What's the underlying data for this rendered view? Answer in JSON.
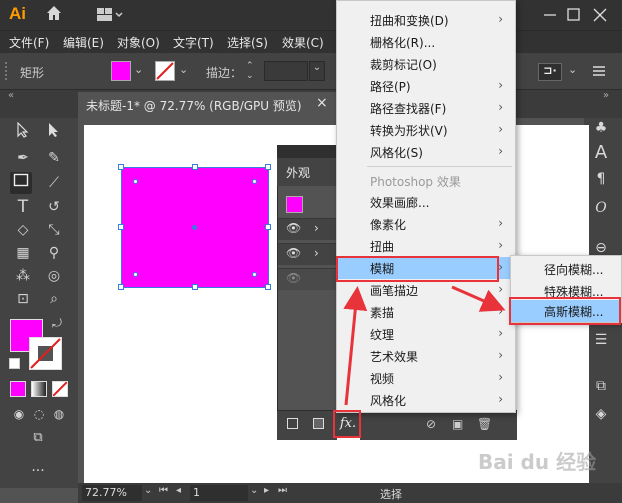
{
  "app": {
    "logo": "Ai"
  },
  "menubar": [
    {
      "label": "文件(F)"
    },
    {
      "label": "编辑(E)"
    },
    {
      "label": "对象(O)"
    },
    {
      "label": "文字(T)"
    },
    {
      "label": "选择(S)"
    },
    {
      "label": "效果(C)"
    }
  ],
  "control_bar": {
    "object_label": "矩形",
    "stroke_label": "描边："
  },
  "document_tab": {
    "title": "未标题-1* @ 72.77% (RGB/GPU 预览)",
    "close": "×"
  },
  "appearance_panel": {
    "title": "外观",
    "fx_label": "fx."
  },
  "effect_menu": {
    "items": [
      {
        "label": "扭曲和变换(D)",
        "has_submenu": true
      },
      {
        "label": "栅格化(R)...",
        "has_submenu": false
      },
      {
        "label": "裁剪标记(O)",
        "has_submenu": false
      },
      {
        "label": "路径(P)",
        "has_submenu": true
      },
      {
        "label": "路径查找器(F)",
        "has_submenu": true
      },
      {
        "label": "转换为形状(V)",
        "has_submenu": true
      },
      {
        "label": "风格化(S)",
        "has_submenu": true
      }
    ],
    "photoshop_header": "Photoshop 效果",
    "ps_items": [
      {
        "label": "效果画廊...",
        "has_submenu": false
      },
      {
        "label": "像素化",
        "has_submenu": true
      },
      {
        "label": "扭曲",
        "has_submenu": true
      },
      {
        "label": "模糊",
        "has_submenu": true,
        "highlighted": true
      },
      {
        "label": "画笔描边",
        "has_submenu": true
      },
      {
        "label": "素描",
        "has_submenu": true
      },
      {
        "label": "纹理",
        "has_submenu": true
      },
      {
        "label": "艺术效果",
        "has_submenu": true
      },
      {
        "label": "视频",
        "has_submenu": true
      },
      {
        "label": "风格化",
        "has_submenu": true
      }
    ]
  },
  "blur_submenu": {
    "items": [
      {
        "label": "径向模糊..."
      },
      {
        "label": "特殊模糊..."
      },
      {
        "label": "高斯模糊...",
        "highlighted": true
      }
    ]
  },
  "statusbar": {
    "zoom": "72.77%",
    "artboard": "1",
    "mode": "选择"
  },
  "colors": {
    "fill": "#ff00ff",
    "highlight": "#99ccff",
    "annotation_red": "#e8333b"
  },
  "watermark": "Bai du 经验"
}
